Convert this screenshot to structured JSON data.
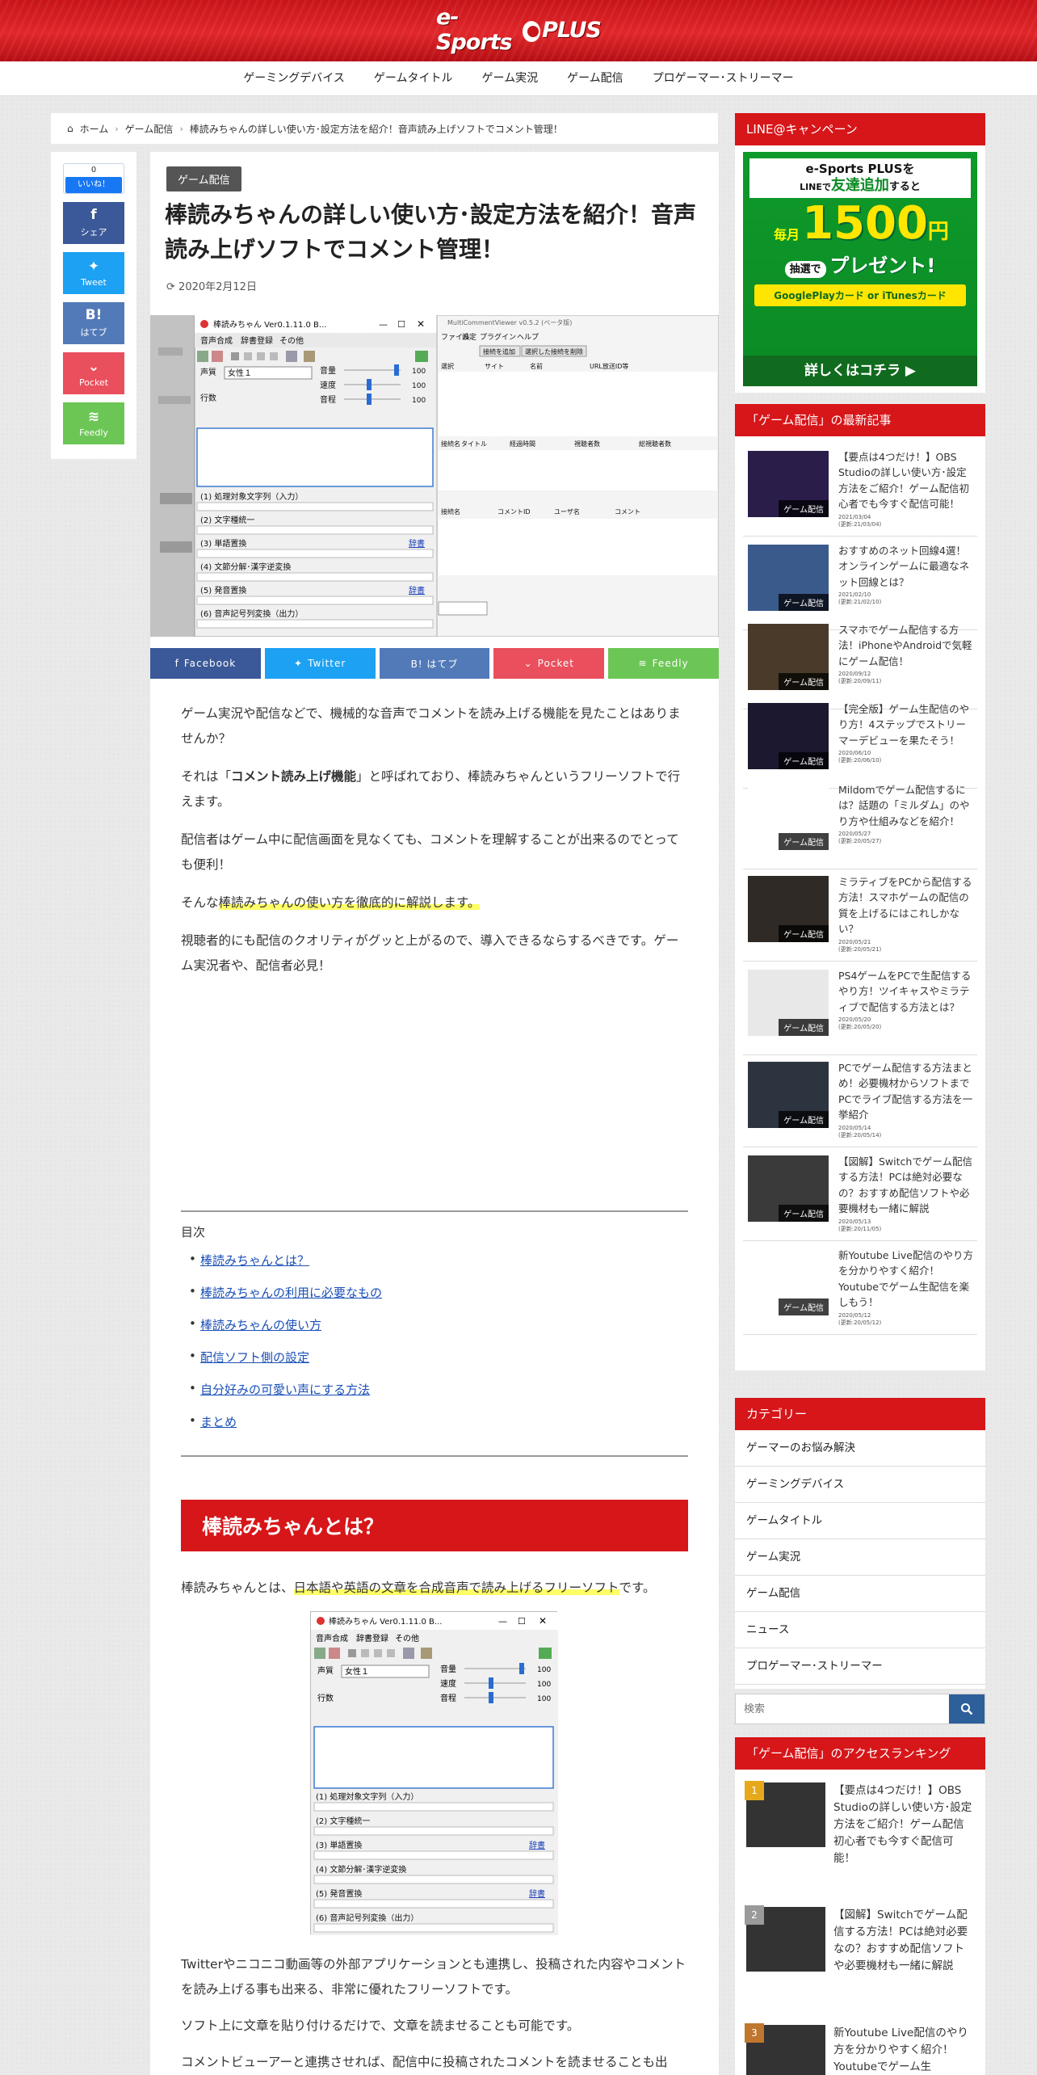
{
  "site": {
    "logo": "e-Sports PLUS"
  },
  "nav": [
    "ゲーミングデバイス",
    "ゲームタイトル",
    "ゲーム実況",
    "ゲーム配信",
    "プロゲーマー･ストリーマー"
  ],
  "breadcrumb": [
    "ホーム",
    "ゲーム配信",
    "棒読みちゃんの詳しい使い方･設定方法を紹介！音声読み上げソフトでコメント管理！"
  ],
  "share": {
    "like_count": "0",
    "like_label": "いいね！",
    "buttons": [
      {
        "icon": "f",
        "label": "シェア",
        "color": "#3b5998"
      },
      {
        "icon": "t",
        "label": "Tweet",
        "color": "#1da1f2"
      },
      {
        "icon": "B!",
        "label": "はてブ",
        "color": "#5279b8"
      },
      {
        "icon": "p",
        "label": "Pocket",
        "color": "#e94f5c"
      },
      {
        "icon": "r",
        "label": "Feedly",
        "color": "#6cc655"
      }
    ]
  },
  "article": {
    "category": "ゲーム配信",
    "title": "棒読みちゃんの詳しい使い方･設定方法を紹介！音声読み上げソフトでコメント管理！",
    "date": "2020年2月12日",
    "sharebar": [
      {
        "label": "Facebook",
        "color": "#3b5998"
      },
      {
        "label": "Twitter",
        "color": "#1da1f2"
      },
      {
        "label": "B! はてブ",
        "color": "#5279b8"
      },
      {
        "label": "Pocket",
        "color": "#e94f5c"
      },
      {
        "label": "Feedly",
        "color": "#6cc655"
      }
    ],
    "hero": {
      "win_title": "棒読みちゃん Ver0.1.11.0 B...",
      "tabs": [
        "音声合成",
        "辞書登録",
        "その他"
      ],
      "voice_label": "声質",
      "voice_value": "女性１",
      "vol": "音量",
      "speed": "速度",
      "pitch": "音程",
      "rows": "行数",
      "val100": "100",
      "sections": [
        "(1) 処理対象文字列（入力）",
        "(2) 文字種統一",
        "(3) 単語置換",
        "(4) 文節分解･漢字逆変換",
        "(5) 発音置換",
        "(6) 音声記号列変換（出力）"
      ],
      "dict": "辞書",
      "mcv_title": "MultiCommentViewer v0.5.2 (ベータ版)",
      "mcv_menu": [
        "ファイル",
        "設定",
        "プラグイン",
        "ヘルプ"
      ],
      "mcv_btns": [
        "接続を追加",
        "選択した接続を削除"
      ],
      "mcv_cols1": [
        "選択",
        "サイト",
        "名前",
        "URL放送ID等"
      ],
      "mcv_cols2": [
        "接続名",
        "タイトル",
        "経過時間",
        "視聴者数",
        "総視聴者数"
      ],
      "mcv_cols3": [
        "接続名",
        "コメントID",
        "ユーザ名",
        "コメント"
      ]
    },
    "p1": "ゲーム実況や配信などで、機械的な音声でコメントを読み上げる機能を見たことはありませんか？",
    "p2a": "それは「",
    "p2b": "コメント読み上げ機能",
    "p2c": "」と呼ばれており、棒読みちゃんというフリーソフトで行えます。",
    "p3": "配信者はゲーム中に配信画面を見なくても、コメントを理解することが出来るのでとっても便利！",
    "p4a": "そんな",
    "p4b": "棒読みちゃんの使い方を徹底的に解説します。",
    "p5": "視聴者的にも配信のクオリティがグッと上がるので、導入できるならするべきです。ゲーム実況者や、配信者必見！",
    "toc_title": "目次",
    "toc": [
      "棒読みちゃんとは？",
      "棒読みちゃんの利用に必要なもの",
      "棒読みちゃんの使い方",
      "配信ソフト側の設定",
      "自分好みの可愛い声にする方法",
      "まとめ"
    ],
    "h2": "棒読みちゃんとは？",
    "p6a": "棒読みちゃんとは、",
    "p6b": "日本語や英語の文章を合成音声で読み上げるフリーソフト",
    "p6c": "です。",
    "p7": "Twitterやニコニコ動画等の外部アプリケーションとも連携し、投稿された内容やコメントを読み上げる事も出来る、非常に優れたフリーソフトです。",
    "p8": "ソフト上に文章を貼り付けるだけで、文章を読ませることも可能です。",
    "p9": "コメントビューアーと連携させれば、配信中に投稿されたコメントを読ませることも出"
  },
  "sidebar": {
    "campaign_title": "LINE@キャンペーン",
    "campaign": {
      "l1": "e-Sports PLUSを",
      "l2a": "LINEで",
      "l2b": "友達追加",
      "l2c": "すると",
      "l3a": "毎月",
      "l3b": "1500",
      "l3c": "円",
      "l4a": "抽選で",
      "l4b": "プレゼント!",
      "l5": "GooglePlayカード or iTunesカード",
      "l6": "詳しくはコチラ ▶"
    },
    "recent_title": "「ゲーム配信」の最新記事",
    "recent": [
      {
        "title": "【要点は4つだけ！】OBS Studioの詳しい使い方･設定方法をご紹介！ゲーム配信初心者でも今すぐ配信可能！",
        "d1": "2021/03/04",
        "d2": "(更新:21/03/04)",
        "thumb": "#2a1d4a"
      },
      {
        "title": "おすすめのネット回線4選！オンラインゲームに最適なネット回線とは？",
        "d1": "2021/02/10",
        "d2": "(更新:21/02/10)",
        "thumb": "#3b5a8c"
      },
      {
        "title": "スマホでゲーム配信する方法！iPhoneやAndroidで気軽にゲーム配信！",
        "d1": "2020/09/12",
        "d2": "(更新:20/09/11)",
        "thumb": "#4a3a2a"
      },
      {
        "title": "【完全版】ゲーム生配信のやり方！4ステップでストリーマーデビューを果たそう！",
        "d1": "2020/06/10",
        "d2": "(更新:20/06/10)",
        "thumb": "#1c1830"
      },
      {
        "title": "Mildomでゲーム配信するには？話題の「ミルダム」のやり方や仕組みなどを紹介！",
        "d1": "2020/05/27",
        "d2": "(更新:20/05/27)",
        "thumb": "#ffffff"
      },
      {
        "title": "ミラティブをPCから配信する方法！スマホゲームの配信の質を上げるにはこれしかない？",
        "d1": "2020/05/21",
        "d2": "(更新:20/05/21)",
        "thumb": "#2f2a26"
      },
      {
        "title": "PS4ゲームをPCで生配信するやり方！ツイキャスやミラティブで配信する方法とは？",
        "d1": "2020/05/20",
        "d2": "(更新:20/05/20)",
        "thumb": "#e8e8e8"
      },
      {
        "title": "PCでゲーム配信する方法まとめ！必要機材からソフトまでPCでライブ配信する方法を一挙紹介",
        "d1": "2020/05/14",
        "d2": "(更新:20/05/14)",
        "thumb": "#2c3440"
      },
      {
        "title": "【図解】Switchでゲーム配信する方法！PCは絶対必要なの？おすすめ配信ソフトや必要機材も一緒に解説",
        "d1": "2020/05/13",
        "d2": "(更新:20/11/05)",
        "thumb": "#3a3a3a"
      },
      {
        "title": "新Youtube Live配信のやり方を分かりやすく紹介！Youtubeでゲーム生配信を楽しもう！",
        "d1": "2020/05/12",
        "d2": "(更新:20/05/12)",
        "thumb": "#ffffff"
      }
    ],
    "thumb_label": "ゲーム配信",
    "categories_title": "カテゴリー",
    "categories": [
      "ゲーマーのお悩み解決",
      "ゲーミングデバイス",
      "ゲームタイトル",
      "ゲーム実況",
      "ゲーム配信",
      "ニュース",
      "プロゲーマー･ストリーマー"
    ],
    "search_placeholder": "検索",
    "ranking_title": "「ゲーム配信」のアクセスランキング",
    "ranking": [
      {
        "num": "1",
        "title": "【要点は4つだけ！】OBS Studioの詳しい使い方･設定方法をご紹介！ゲーム配信初心者でも今すぐ配信可能！",
        "color": "#e6a91c"
      },
      {
        "num": "2",
        "title": "【図解】Switchでゲーム配信する方法！PCは絶対必要なの？おすすめ配信ソフトや必要機材も一緒に解説",
        "color": "#9a9a9a"
      },
      {
        "num": "3",
        "title": "新Youtube Live配信のやり方を分かりやすく紹介！Youtubeでゲーム生",
        "color": "#c0762c"
      }
    ]
  }
}
